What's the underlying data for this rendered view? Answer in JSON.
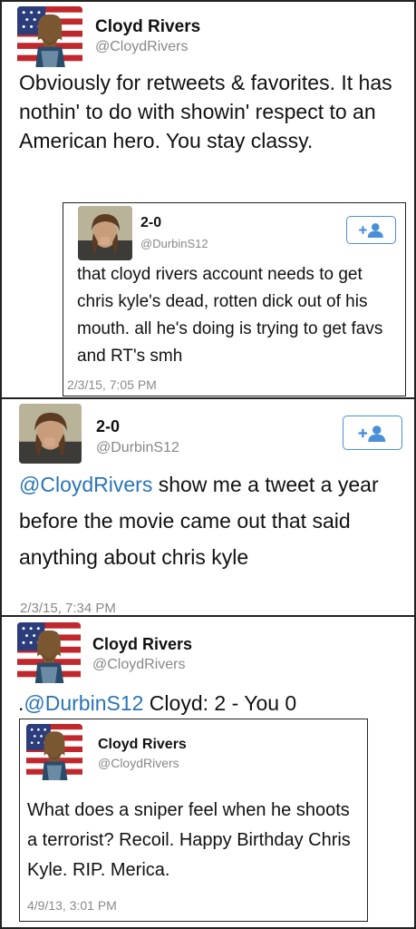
{
  "tweet1": {
    "name": "Cloyd Rivers",
    "handle": "@CloydRivers",
    "text": "Obviously for retweets & favorites. It has nothin' to do with showin' respect to an American hero. You stay classy.",
    "quoted": {
      "name": "2-0",
      "handle": "@DurbinS12",
      "text": "that cloyd rivers account needs to get chris kyle's dead, rotten dick out of his mouth. all he's doing is trying to get favs and RT's smh",
      "timestamp": "2/3/15, 7:05 PM"
    }
  },
  "tweet2": {
    "name": "2-0",
    "handle": "@DurbinS12",
    "mention": "@CloydRivers",
    "text_rest": " show me a tweet a year before the movie came out that said anything about chris kyle",
    "timestamp": "2/3/15, 7:34 PM"
  },
  "tweet3": {
    "name": "Cloyd Rivers",
    "handle": "@CloydRivers",
    "prefix": ".",
    "mention": "@DurbinS12",
    "text_rest": " Cloyd: 2 - You 0",
    "quoted": {
      "name": "Cloyd Rivers",
      "handle": "@CloydRivers",
      "text": "What does a sniper feel when he shoots a terrorist? Recoil. Happy Birthday Chris Kyle. RIP. Merica.",
      "timestamp": "4/9/13, 3:01 PM"
    }
  },
  "icons": {
    "follow": "follow-icon",
    "avatar_cloyd": "flag-cartoon-avatar",
    "avatar_durbin": "photo-avatar"
  },
  "colors": {
    "mention": "#2a75b5",
    "follow_border": "#4a90d6"
  }
}
